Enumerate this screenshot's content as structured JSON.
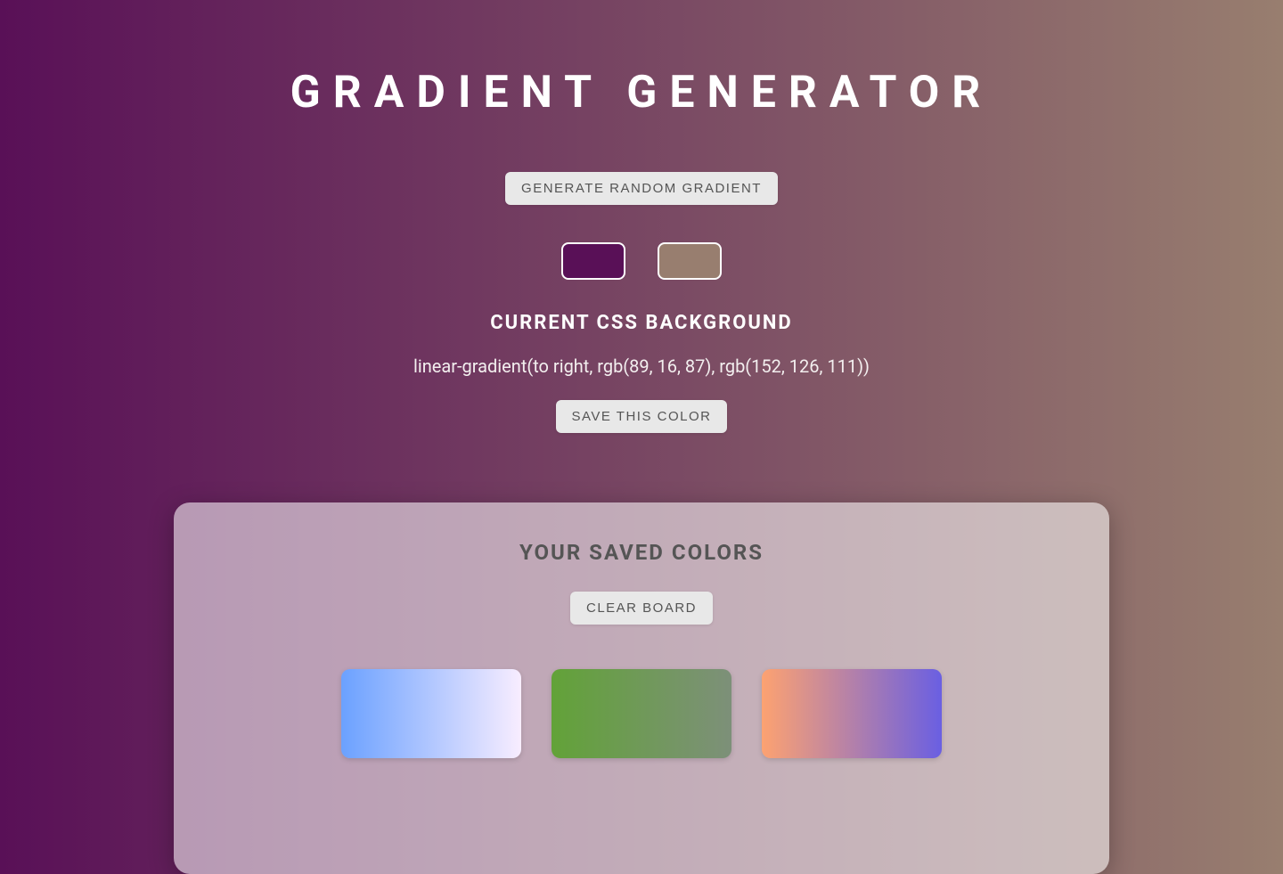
{
  "title": "GRADIENT GENERATOR",
  "buttons": {
    "generate": "GENERATE RANDOM GRADIENT",
    "save": "SAVE THIS COLOR",
    "clear": "CLEAR BOARD"
  },
  "current": {
    "label": "CURRENT CSS BACKGROUND",
    "css_string": "linear-gradient(to right, rgb(89, 16, 87), rgb(152, 126, 111))",
    "color1": "#591057",
    "color2": "#987e6f"
  },
  "saved": {
    "title": "YOUR SAVED COLORS",
    "swatches": [
      {
        "css": "linear-gradient(to right, rgb(107, 161, 255), rgb(248, 237, 255))"
      },
      {
        "css": "linear-gradient(to right, rgb(98, 162, 56), rgb(125, 144, 121))"
      },
      {
        "css": "linear-gradient(to right, rgb(253, 162, 113), rgb(106, 95, 226))"
      }
    ]
  }
}
